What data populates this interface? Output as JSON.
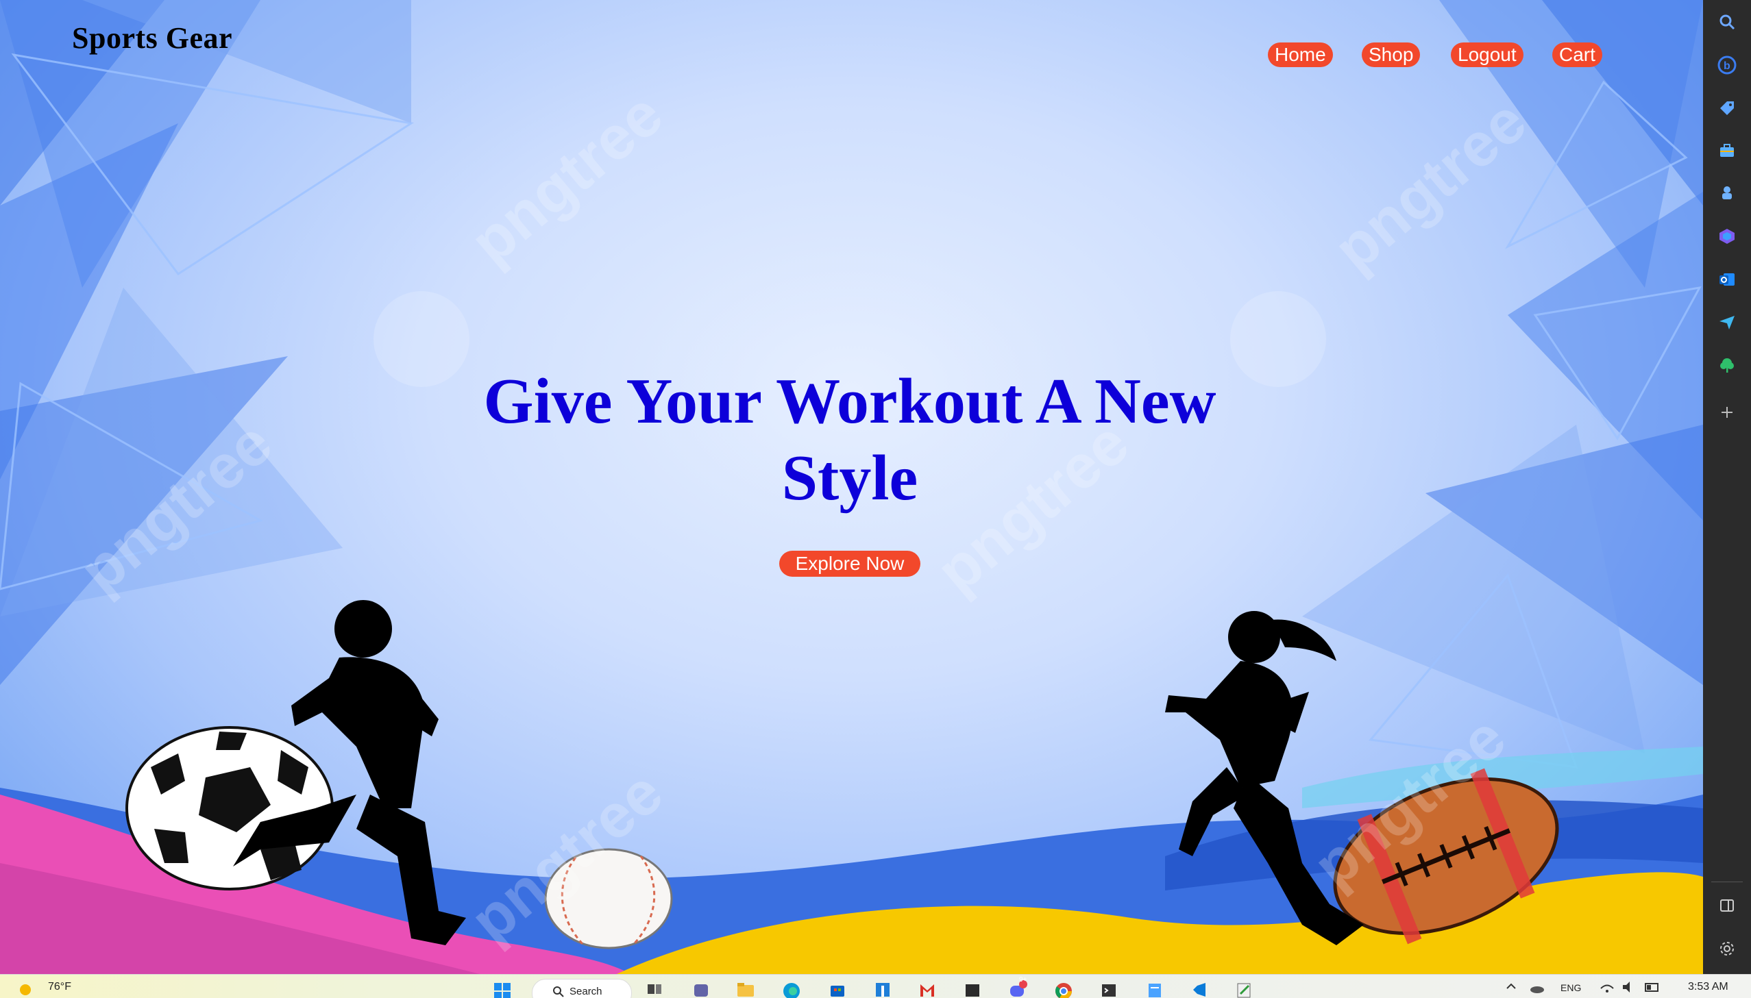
{
  "site": {
    "brand": "Sports Gear",
    "nav": {
      "home": "Home",
      "shop": "Shop",
      "logout": "Logout",
      "cart": "Cart"
    },
    "hero": {
      "title": "Give Your Workout A New Style",
      "cta": "Explore Now"
    },
    "watermark": "pngtree"
  },
  "colors": {
    "accent": "#f2482b",
    "hero_text": "#0d00d9",
    "sidebar": "#2b2b2b"
  },
  "edge_sidebar": {
    "icons": [
      "search-icon",
      "bing-icon",
      "tag-icon",
      "briefcase-icon",
      "games-icon",
      "copilot-icon",
      "outlook-icon",
      "send-icon",
      "tree-icon",
      "add-icon",
      "split-screen-icon",
      "settings-icon"
    ]
  },
  "taskbar": {
    "weather": "76°F",
    "search_label": "Search",
    "language": "ENG",
    "time": "3:53 AM",
    "notification_badge": "9+",
    "apps": [
      "start-icon",
      "search-icon",
      "task-view-icon",
      "teams-icon",
      "file-explorer-icon",
      "edge-icon",
      "store-icon",
      "app-icon",
      "gmail-icon",
      "terminal-icon",
      "discord-icon",
      "chrome-icon",
      "terminal2-icon",
      "notepad-icon",
      "vscode-icon",
      "editor-icon"
    ]
  }
}
